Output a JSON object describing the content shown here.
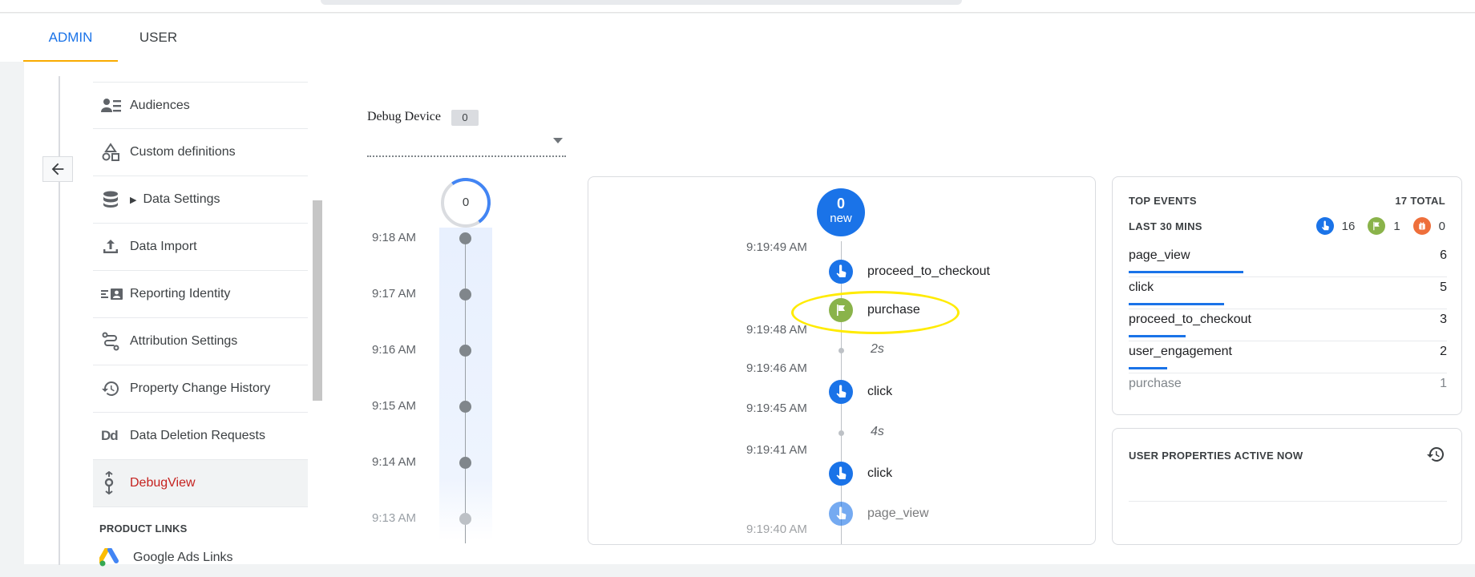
{
  "tabs": {
    "admin": "ADMIN",
    "user": "USER"
  },
  "sidebar": {
    "items": [
      {
        "label": "Audiences",
        "icon": "audiences-icon"
      },
      {
        "label": "Custom definitions",
        "icon": "shapes-icon"
      },
      {
        "label": "Data Settings",
        "icon": "database-icon"
      },
      {
        "label": "Data Import",
        "icon": "upload-icon"
      },
      {
        "label": "Reporting Identity",
        "icon": "reporting-identity-icon"
      },
      {
        "label": "Attribution Settings",
        "icon": "attribution-icon"
      },
      {
        "label": "Property Change History",
        "icon": "history-icon"
      },
      {
        "label": "Data Deletion Requests",
        "icon": "dd-icon"
      },
      {
        "label": "DebugView",
        "icon": "debugview-icon"
      }
    ],
    "product_links_heading": "PRODUCT LINKS",
    "google_ads_links": "Google Ads Links"
  },
  "debug_device": {
    "label": "Debug Device",
    "count": "0"
  },
  "minutes": {
    "counter": "0",
    "rows": [
      "9:18 AM",
      "9:17 AM",
      "9:16 AM",
      "9:15 AM",
      "9:14 AM",
      "9:13 AM"
    ]
  },
  "seconds": {
    "new_count": "0",
    "new_label": "new",
    "times": [
      "9:19:49 AM",
      "9:19:48 AM",
      "9:19:46 AM",
      "9:19:45 AM",
      "9:19:41 AM",
      "9:19:40 AM"
    ],
    "events": [
      "proceed_to_checkout",
      "purchase",
      "click",
      "click",
      "page_view"
    ],
    "gaps": [
      "2s",
      "4s"
    ]
  },
  "top_events": {
    "title": "TOP EVENTS",
    "total": "17 TOTAL",
    "subtitle": "LAST 30 MINS",
    "counts": {
      "events": "16",
      "conversions": "1",
      "errors": "0"
    },
    "rows": [
      {
        "name": "page_view",
        "value": "6",
        "fraction": 0.36
      },
      {
        "name": "click",
        "value": "5",
        "fraction": 0.3
      },
      {
        "name": "proceed_to_checkout",
        "value": "3",
        "fraction": 0.18
      },
      {
        "name": "user_engagement",
        "value": "2",
        "fraction": 0.12
      },
      {
        "name": "purchase",
        "value": "1",
        "fraction": 0
      }
    ]
  },
  "user_properties": {
    "title": "USER PROPERTIES ACTIVE NOW"
  },
  "colors": {
    "accent": "#1a73e8",
    "tab_indicator": "#f9ab00",
    "conversion": "#8ab34a",
    "error": "#ee6f3b",
    "highlight": "#ffeb00",
    "active_nav": "#c5221f"
  }
}
